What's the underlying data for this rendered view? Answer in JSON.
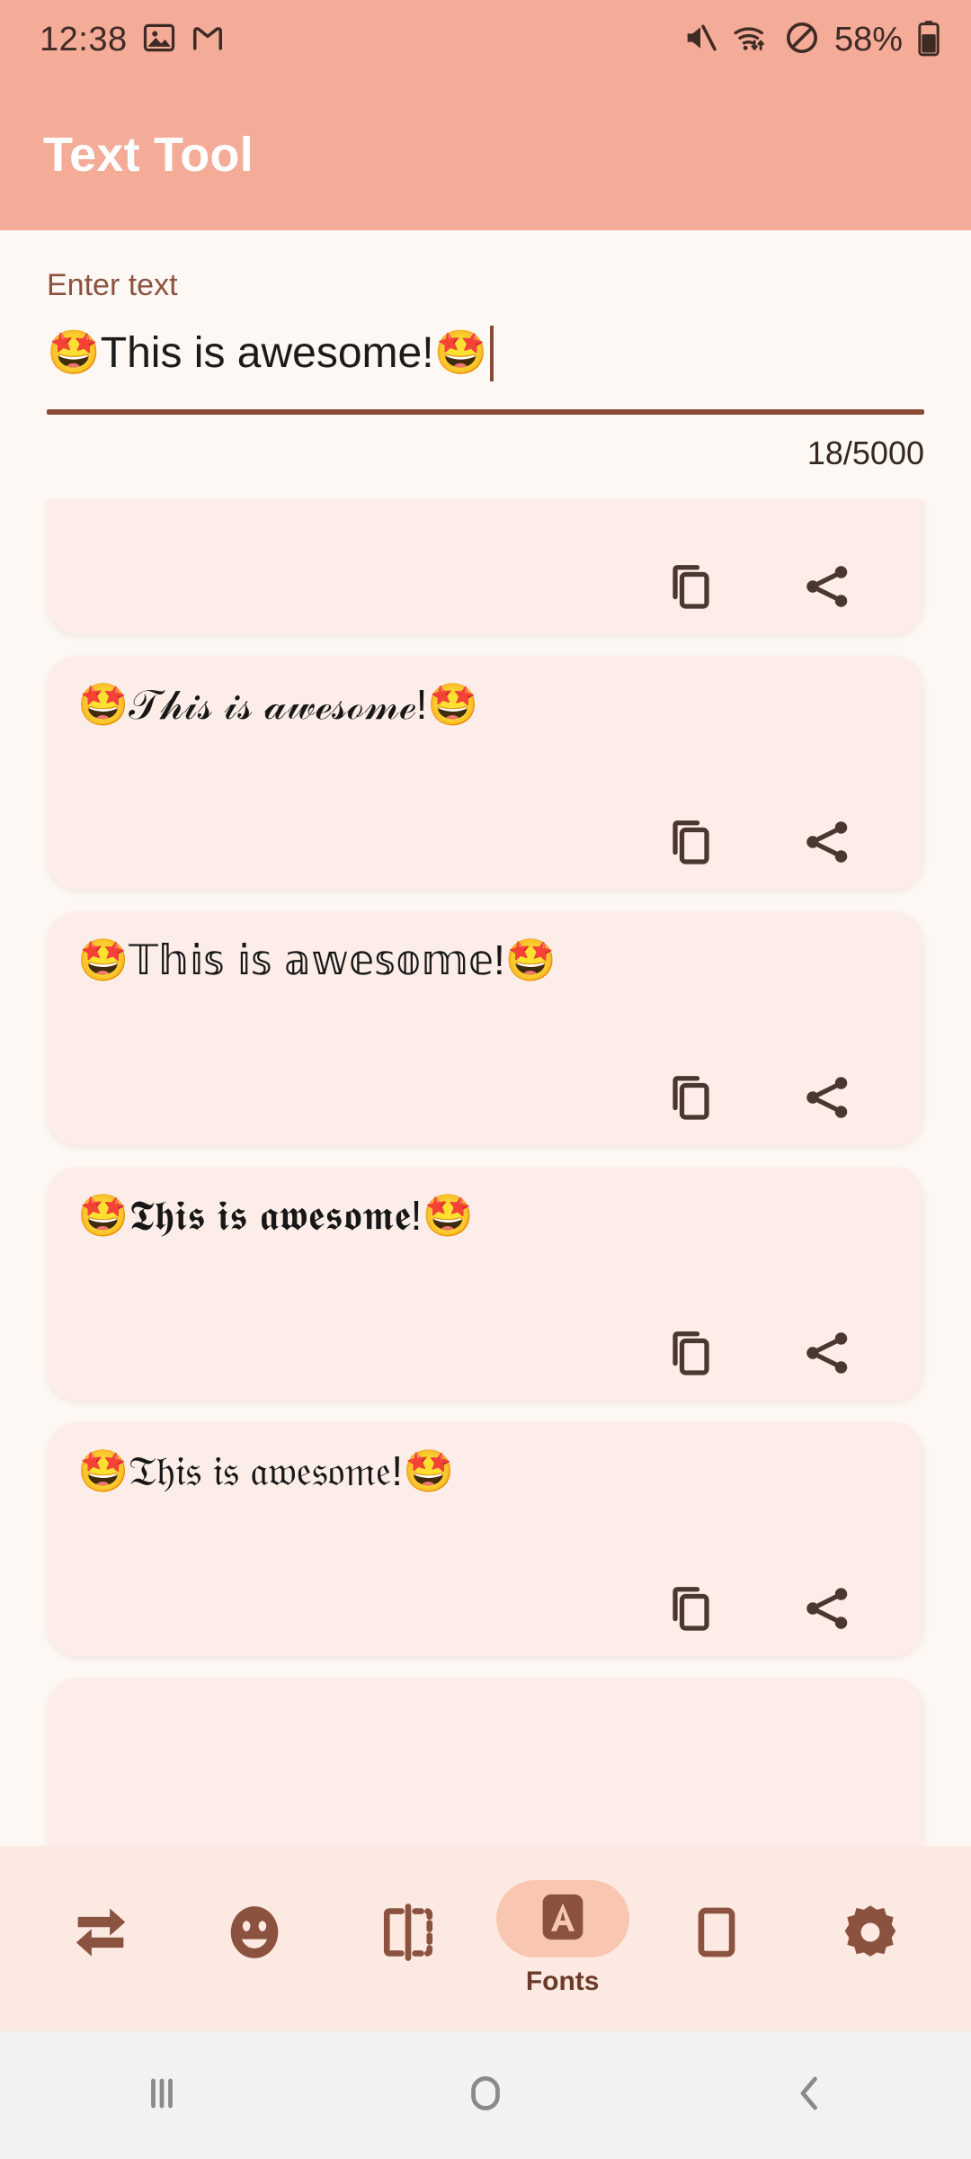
{
  "status_bar": {
    "time": "12:38",
    "battery_percent": "58%",
    "left_icons": [
      "photos-icon",
      "gmail-icon"
    ],
    "right_icons": [
      "mute-icon",
      "wifi-icon",
      "do-not-disturb-icon",
      "battery-icon"
    ]
  },
  "app_bar": {
    "title": "Text Tool",
    "background": "#F4AB97"
  },
  "input": {
    "label": "Enter text",
    "value": "🤩This is awesome!🤩",
    "placeholder": "Enter text",
    "counter": "18/5000",
    "underline_color": "#8B4A35"
  },
  "results": {
    "cards": [
      {
        "text": "",
        "clipped": true,
        "copy_label": "copy-icon",
        "share_label": "share-icon"
      },
      {
        "text": "🤩𝒯𝒽𝒾𝓈 𝒾𝓈 𝒶𝓌ℯ𝓈ℴ𝓂ℯ!🤩",
        "style": "script",
        "clipped": false,
        "copy_label": "copy-icon",
        "share_label": "share-icon"
      },
      {
        "text": "🤩𝕋𝕙𝕚𝕤 𝕚𝕤 𝕒𝕨𝕖𝕤𝕠𝕞𝕖!🤩",
        "style": "outline-thin",
        "clipped": false,
        "copy_label": "copy-icon",
        "share_label": "share-icon"
      },
      {
        "text": "🤩𝕿𝖍𝖎𝖘 𝖎𝖘 𝖆𝖜𝖊𝖘𝖔𝖒𝖊!🤩",
        "style": "fraktur-bold",
        "clipped": false,
        "copy_label": "copy-icon",
        "share_label": "share-icon"
      },
      {
        "text": "🤩𝔗𝔥𝔦𝔰 𝔦𝔰 𝔞𝔴𝔢𝔰𝔬𝔪𝔢!🤩",
        "style": "fraktur",
        "clipped": false,
        "copy_label": "copy-icon",
        "share_label": "share-icon"
      },
      {
        "text": "",
        "style": "partial",
        "clipped": false,
        "copy_label": "copy-icon",
        "share_label": "share-icon"
      }
    ]
  },
  "toolbar": {
    "background": "#FCEAE2",
    "accent": "#F9C6B1",
    "icon_color": "#8C5240",
    "items": [
      {
        "name": "repeat",
        "label": "",
        "icon": "repeat-icon",
        "active": false
      },
      {
        "name": "emoji",
        "label": "",
        "icon": "emoji-icon",
        "active": false
      },
      {
        "name": "mirror",
        "label": "",
        "icon": "mirror-icon",
        "active": false
      },
      {
        "name": "fonts",
        "label": "Fonts",
        "icon": "fonts-icon",
        "active": true
      },
      {
        "name": "frame",
        "label": "",
        "icon": "frame-icon",
        "active": false
      },
      {
        "name": "settings",
        "label": "",
        "icon": "gear-icon",
        "active": false
      }
    ]
  },
  "nav_bar": {
    "buttons": [
      "recents-icon",
      "home-icon",
      "back-icon"
    ],
    "color": "#8A8A8A"
  }
}
